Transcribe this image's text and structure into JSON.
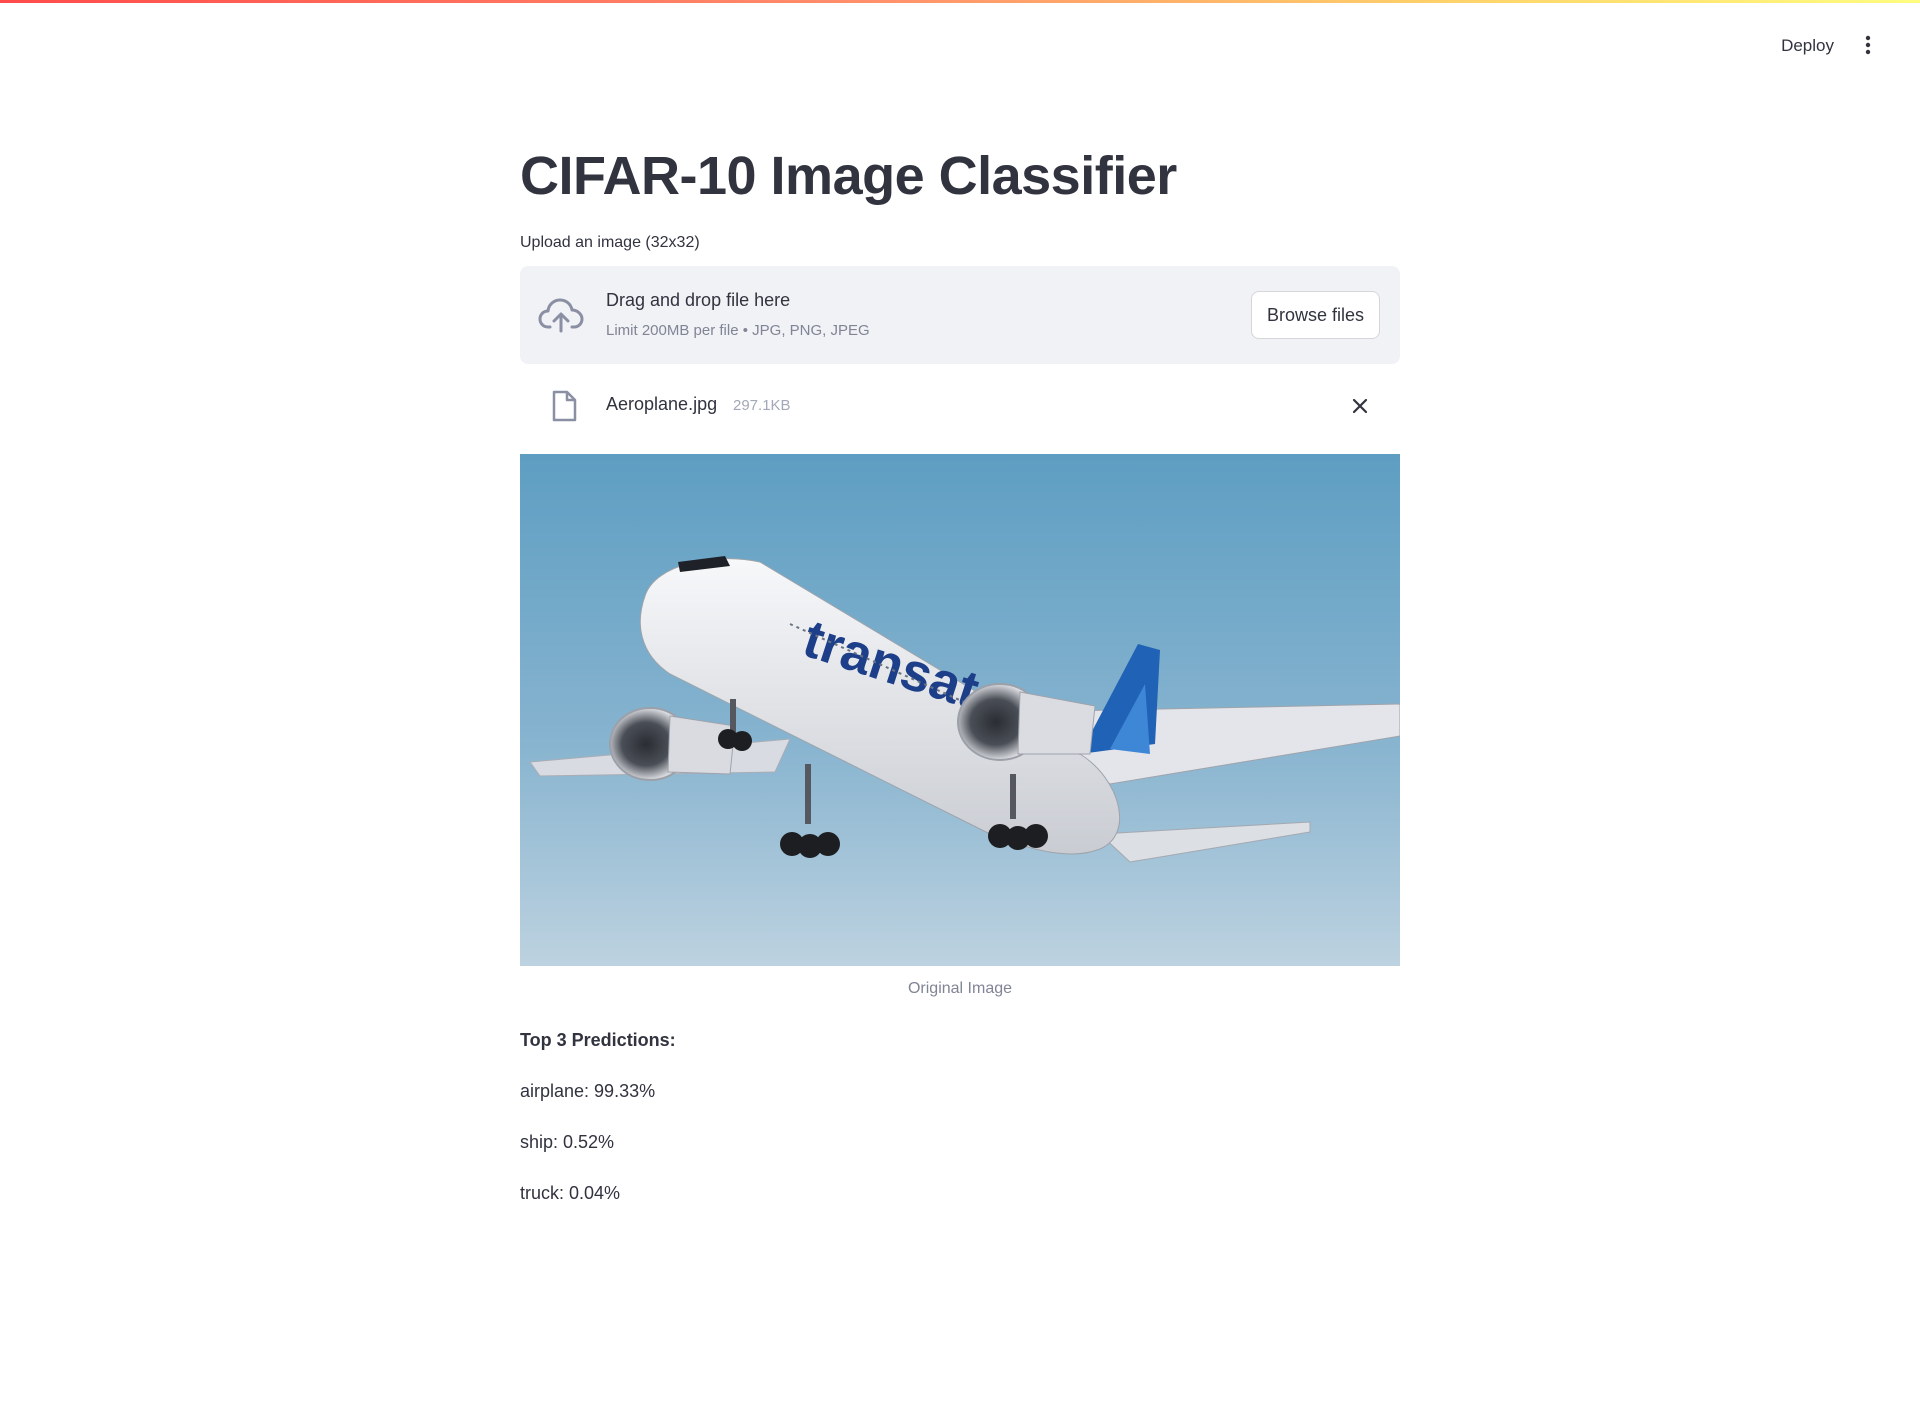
{
  "header": {
    "deploy_label": "Deploy",
    "menu_icon": "kebab-menu-icon"
  },
  "main": {
    "title": "CIFAR-10 Image Classifier",
    "upload_label": "Upload an image (32x32)",
    "dropzone": {
      "title": "Drag and drop file here",
      "limit": "Limit 200MB per file • JPG, PNG, JPEG",
      "browse_label": "Browse files",
      "icon": "cloud-upload-icon"
    },
    "uploaded_file": {
      "name": "Aeroplane.jpg",
      "size": "297.1KB",
      "icon": "file-icon"
    },
    "image": {
      "caption": "Original Image",
      "brand_text": "transat"
    },
    "predictions": {
      "title": "Top 3 Predictions:",
      "items": [
        {
          "text": "airplane: 99.33%"
        },
        {
          "text": "ship: 0.52%"
        },
        {
          "text": "truck: 0.04%"
        }
      ]
    }
  },
  "colors": {
    "accent_gradient_start": "#ff4b4b",
    "accent_gradient_end": "#fffd80",
    "text": "#31333f",
    "muted": "#808495",
    "dropzone_bg": "#f0f2f6"
  }
}
